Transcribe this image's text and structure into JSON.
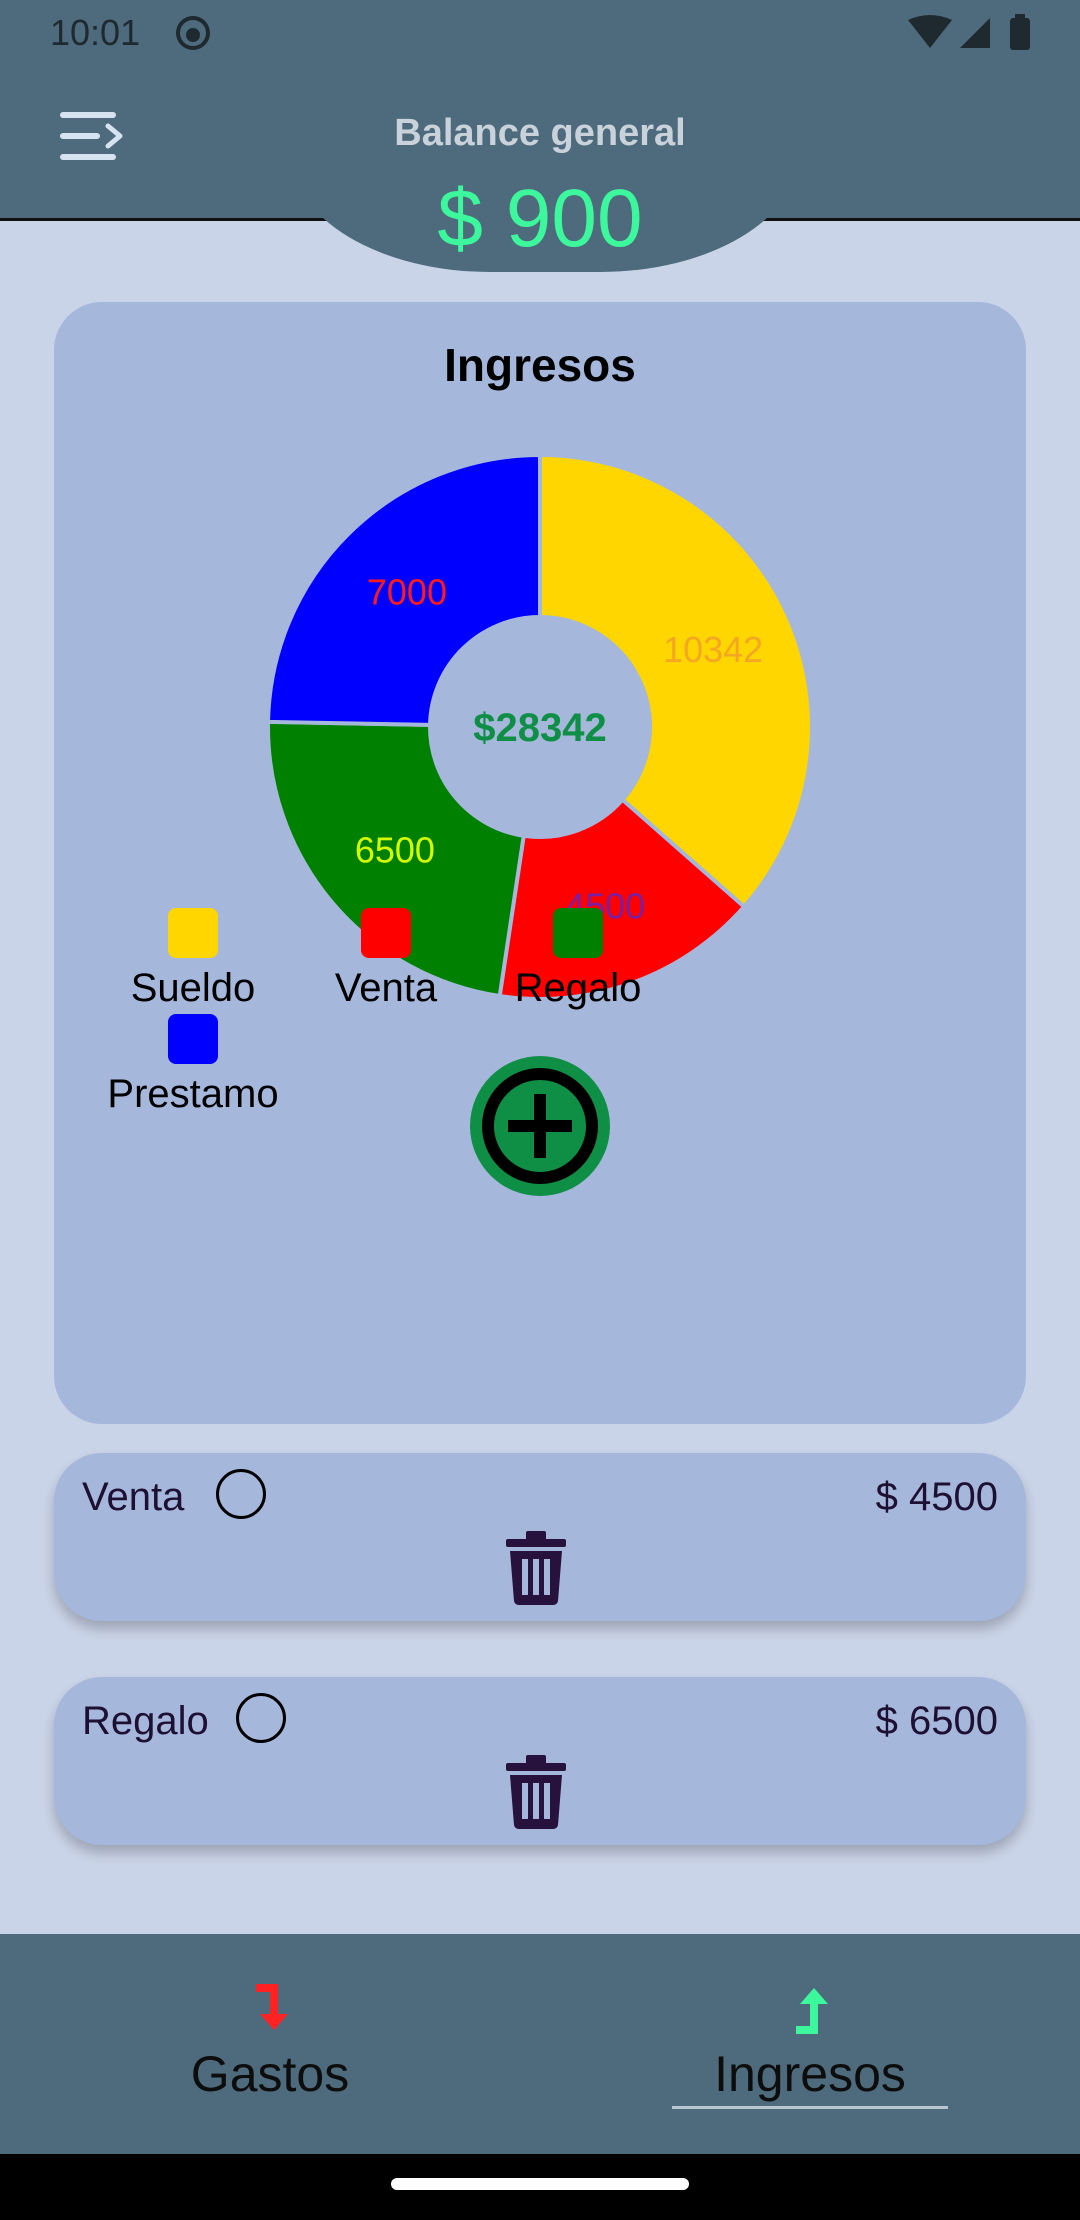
{
  "status_bar": {
    "time": "10:01"
  },
  "header": {
    "title": "Balance general",
    "balance": "$ 900"
  },
  "chart_card": {
    "title": "Ingresos",
    "add_icon": "add-circle-icon"
  },
  "chart_data": {
    "type": "pie",
    "title": "Ingresos",
    "center_label": "$28342",
    "slices": [
      {
        "label": "Sueldo",
        "value": 10342,
        "color": "#ffd600",
        "label_color": "#f5a623"
      },
      {
        "label": "Venta",
        "value": 4500,
        "color": "#ff0000",
        "label_color": "#7b1fa2"
      },
      {
        "label": "Regalo",
        "value": 6500,
        "color": "#008000",
        "label_color": "#d4ff00"
      },
      {
        "label": "Prestamo",
        "value": 7000,
        "color": "#0000ff",
        "label_color": "#ff1a1a"
      }
    ],
    "legend_position": "bottom"
  },
  "entries": [
    {
      "name": "Venta",
      "amount": "$ 4500"
    },
    {
      "name": "Regalo",
      "amount": "$ 6500"
    }
  ],
  "bottom_nav": {
    "items": [
      {
        "label": "Gastos",
        "icon": "arrow-down-icon",
        "color": "#ff2222"
      },
      {
        "label": "Ingresos",
        "icon": "arrow-up-icon",
        "color": "#3df79c",
        "selected": true
      }
    ]
  },
  "colors": {
    "background": "#cad4e8",
    "primary": "#4d6b7c",
    "card": "#a6b7dc",
    "balance": "#3df79c",
    "add_button": "#0e8f45"
  }
}
